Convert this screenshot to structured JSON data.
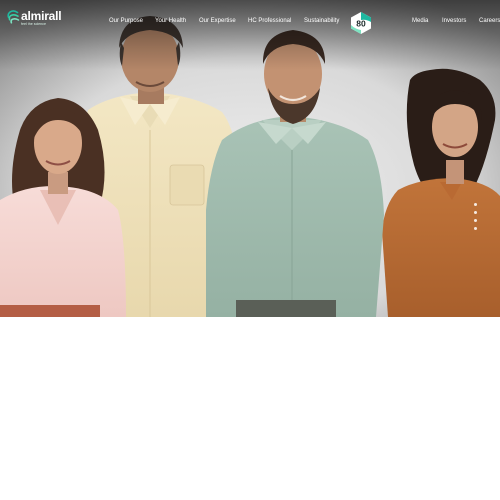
{
  "brand": {
    "name": "almirall",
    "tagline": "feel the science",
    "logo_icon": "almirall-logo-icon",
    "accent_color": "#1fb8a0",
    "text_color": "#ffffff"
  },
  "nav": {
    "left_items": [
      {
        "label": "Our Purpose"
      },
      {
        "label": "Your Health"
      },
      {
        "label": "Our Expertise"
      },
      {
        "label": "HC Professional"
      },
      {
        "label": "Sustainability"
      }
    ],
    "badge": {
      "label": "80",
      "icon": "anniversary-80-badge-icon"
    },
    "right_items": [
      {
        "label": "Media"
      },
      {
        "label": "Investors"
      },
      {
        "label": "Careers"
      }
    ]
  },
  "hero": {
    "image": "team-photo",
    "people": [
      "woman-pink-blouse",
      "man-beige-shirt",
      "man-green-shirt",
      "woman-rust-dress"
    ],
    "slide_count": 4,
    "active_slide": 1
  }
}
